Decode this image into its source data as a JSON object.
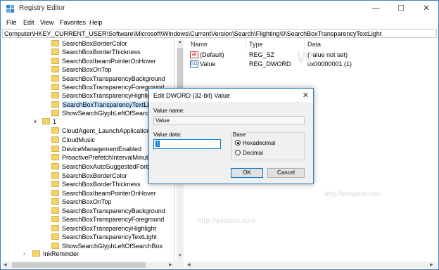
{
  "window": {
    "title": "Registry Editor",
    "controls": {
      "minimize": "—",
      "maximize": "☐",
      "close": "✕"
    }
  },
  "menu": [
    "File",
    "Edit",
    "View",
    "Favorites",
    "Help"
  ],
  "address": "Computer\\HKEY_CURRENT_USER\\Software\\Microsoft\\Windows\\CurrentVersion\\Search\\Flighting\\0\\SearchBoxTransparencyTextLight",
  "tree": {
    "items_top": [
      "SearchBoxBorderColor",
      "SearchBoxBorderThickness",
      "SearchBoxIbeamPointerOnHover",
      "SearchBoxOnTop",
      "SearchBoxTransparencyBackground",
      "SearchBoxTransparencyForeground",
      "SearchBoxTransparencyHighlight",
      "SearchBoxTransparencyTextLight",
      "ShowSearchGlyphLeftOfSearchBox"
    ],
    "group_label": "1",
    "items_bottom": [
      "CloudAgent_LaunchApplication",
      "CloudMusic",
      "DeviceManagementEnabled",
      "ProactivePrefetchIntervalMinutes",
      "SearchBoxAutoSuggestedForegroundColor",
      "SearchBoxBorderColor",
      "SearchBoxBorderThickness",
      "SearchBoxIbeamPointerOnHover",
      "SearchBoxOnTop",
      "SearchBoxTransparencyBackground",
      "SearchBoxTransparencyForeground",
      "SearchBoxTransparencyHighlight",
      "SearchBoxTransparencyTextLight",
      "ShowSearchGlyphLeftOfSearchBox"
    ],
    "last_item": "InkReminder"
  },
  "values_list": {
    "columns": [
      "Name",
      "Type",
      "Data"
    ],
    "rows": [
      {
        "icon": "string-value-icon",
        "name": "(Default)",
        "type": "REG_SZ",
        "data": "(value not set)"
      },
      {
        "icon": "dword-value-icon",
        "name": "Value",
        "type": "REG_DWORD",
        "data": "0x00000001 (1)"
      }
    ]
  },
  "dialog": {
    "title": "Edit DWORD (32-bit) Value",
    "value_name_label": "Value name:",
    "value_name": "Value",
    "value_data_label": "Value data:",
    "value_data": "1",
    "base_label": "Base",
    "radio_hex": "Hexadecimal",
    "radio_dec": "Decimal",
    "selected_base": "Hexadecimal",
    "ok": "OK",
    "cancel": "Cancel"
  },
  "watermark": "http://winaero.com",
  "colors": {
    "accent": "#1979ca",
    "selection": "#cce8ff",
    "folder": "#f3d36a"
  }
}
